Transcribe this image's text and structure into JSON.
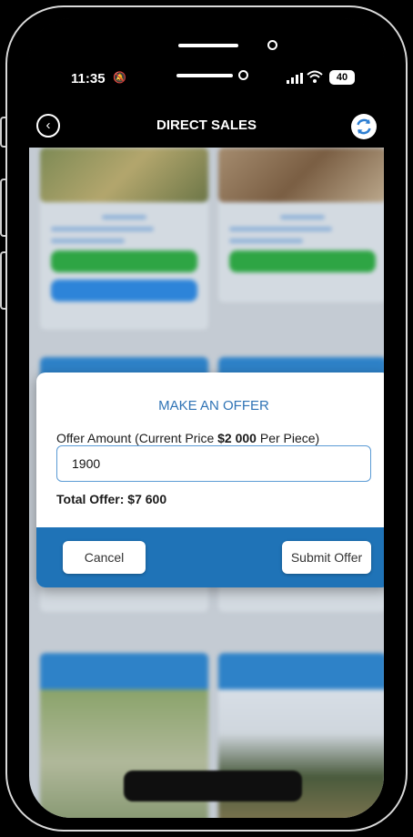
{
  "status_bar": {
    "time": "11:35",
    "signal": "..ıl",
    "battery": "40"
  },
  "header": {
    "title": "DIRECT SALES"
  },
  "modal": {
    "title": "MAKE AN OFFER",
    "offer_label_prefix": "Offer Amount (Current Price ",
    "current_price": "$2 000",
    "offer_label_suffix": " Per Piece)",
    "offer_value": "1900",
    "total": "Total Offer: $7 600",
    "cancel_label": "Cancel",
    "submit_label": "Submit Offer"
  },
  "colors": {
    "header_bg": "#000000",
    "modal_title": "#2f73b5",
    "footer_bg": "#1f73b7",
    "green_button": "#2ea544",
    "blue_button": "#2d84d9"
  }
}
